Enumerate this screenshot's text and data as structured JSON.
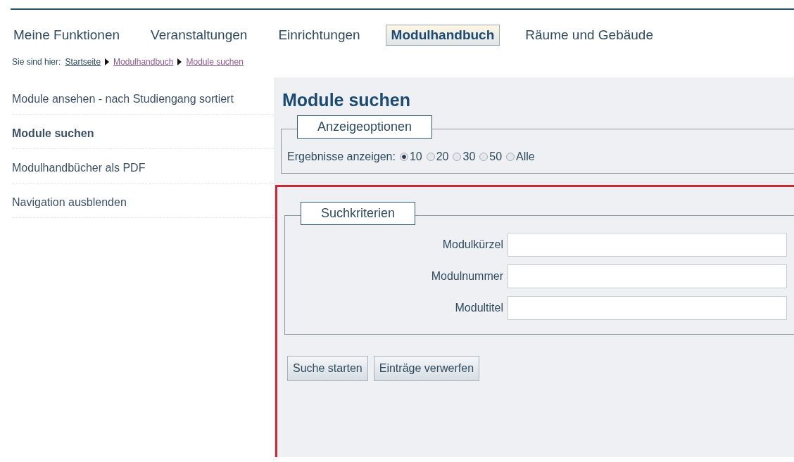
{
  "nav_tabs": [
    {
      "label": "Meine Funktionen",
      "selected": false
    },
    {
      "label": "Veranstaltungen",
      "selected": false
    },
    {
      "label": "Einrichtungen",
      "selected": false
    },
    {
      "label": "Modulhandbuch",
      "selected": true
    },
    {
      "label": "Räume und Gebäude",
      "selected": false
    }
  ],
  "breadcrumb": {
    "label": "Sie sind hier:",
    "items": [
      {
        "label": "Startseite",
        "visited": false
      },
      {
        "label": "Modulhandbuch",
        "visited": true
      },
      {
        "label": "Module suchen",
        "visited": true
      }
    ]
  },
  "sidebar": {
    "items": [
      {
        "label": "Module ansehen - nach Studiengang sortiert",
        "selected": false
      },
      {
        "label": "Module suchen",
        "selected": true
      },
      {
        "label": "Modulhandbücher als PDF",
        "selected": false
      },
      {
        "label": "Navigation ausblenden",
        "selected": false
      }
    ]
  },
  "page_title": "Module suchen",
  "display_options": {
    "legend": "Anzeigeoptionen",
    "label": "Ergebnisse anzeigen:",
    "options": [
      {
        "label": "10",
        "selected": true
      },
      {
        "label": "20",
        "selected": false
      },
      {
        "label": "30",
        "selected": false
      },
      {
        "label": "50",
        "selected": false
      },
      {
        "label": "Alle",
        "selected": false
      }
    ]
  },
  "search_criteria": {
    "legend": "Suchkriterien",
    "fields": [
      {
        "label": "Modulkürzel"
      },
      {
        "label": "Modulnummer"
      },
      {
        "label": "Modultitel"
      }
    ]
  },
  "buttons": [
    "Suche starten",
    "Einträge verwerfen"
  ]
}
